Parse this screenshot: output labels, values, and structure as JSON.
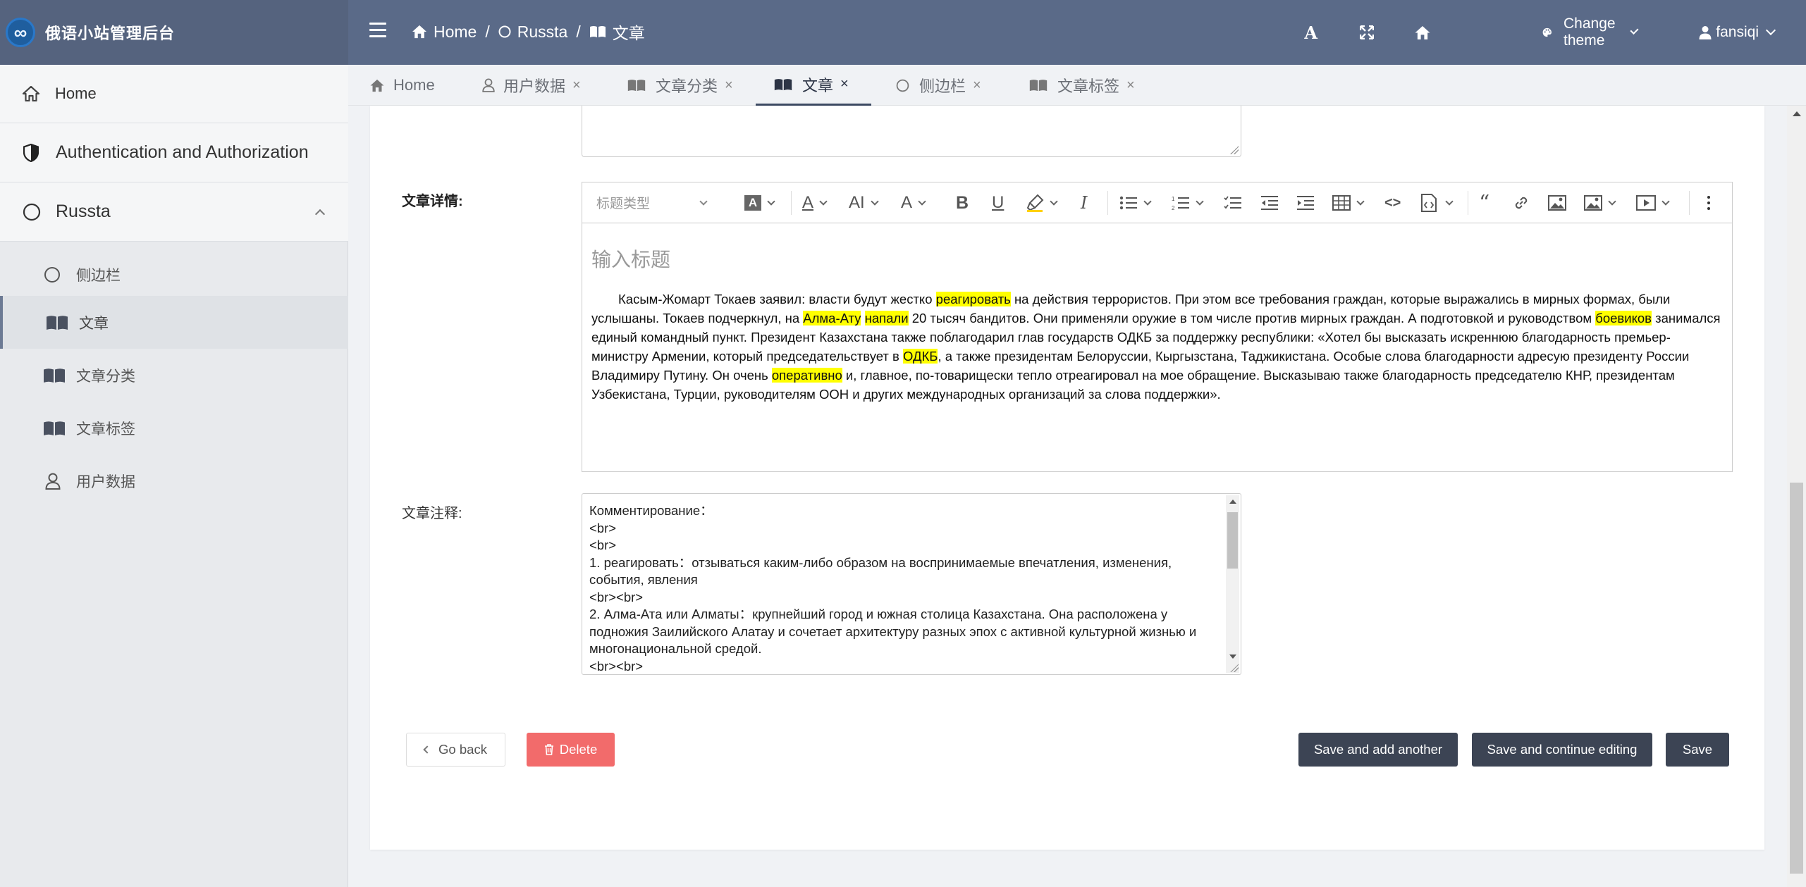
{
  "app": {
    "title": "俄语小站管理后台",
    "logo_glyph": "∞"
  },
  "breadcrumb": [
    {
      "label": "Home",
      "icon": "home-icon"
    },
    {
      "label": "Russta",
      "icon": "circle-icon"
    },
    {
      "label": "文章",
      "icon": "book-icon"
    }
  ],
  "breadcrumb_sep": "/",
  "header_right": {
    "font_icon": "A",
    "theme_label": "Change theme",
    "user_label": "fansiqi"
  },
  "sidebar": {
    "home": "Home",
    "auth": "Authentication and Authorization",
    "russta": "Russta",
    "items": [
      {
        "label": "侧边栏",
        "icon": "circle-icon"
      },
      {
        "label": "文章",
        "icon": "book-icon"
      },
      {
        "label": "文章分类",
        "icon": "book-icon"
      },
      {
        "label": "文章标签",
        "icon": "book-icon"
      },
      {
        "label": "用户数据",
        "icon": "user-icon"
      }
    ]
  },
  "tabs": [
    {
      "label": "Home",
      "icon": "home-icon",
      "closable": false
    },
    {
      "label": "用户数据",
      "icon": "user-icon",
      "closable": true
    },
    {
      "label": "文章分类",
      "icon": "book-icon",
      "closable": true
    },
    {
      "label": "文章",
      "icon": "book-icon",
      "closable": true,
      "active": true
    },
    {
      "label": "侧边栏",
      "icon": "circle-icon",
      "closable": true
    },
    {
      "label": "文章标签",
      "icon": "book-icon",
      "closable": true
    }
  ],
  "close_glyph": "×",
  "form": {
    "detail_label": "文章详情:",
    "notes_label": "文章注释:",
    "editor": {
      "heading_select": "标题类型",
      "title_placeholder": "输入标题",
      "body": [
        {
          "t": "Касым-Жомарт Токаев заявил: власти будут жестко "
        },
        {
          "t": "реагировать",
          "hl": true
        },
        {
          "t": " на действия террористов. При этом все требования граждан, которые выражались в мирных формах, были услышаны. Токаев подчеркнул, на "
        },
        {
          "t": "Алма-Ату",
          "hl": true
        },
        {
          "t": " "
        },
        {
          "t": "напали",
          "hl": true
        },
        {
          "t": " 20 тысяч бандитов. Они применяли оружие в том числе против мирных граждан. А подготовкой и руководством "
        },
        {
          "t": "боевиков",
          "hl": true
        },
        {
          "t": " занимался единый командный пункт. Президент Казахстана также поблагодарил глав государств ОДКБ за поддержку республики: «Хотел бы высказать искреннюю благодарность премьер-министру Армении, который председательствует в "
        },
        {
          "t": "ОДКБ",
          "hl": true
        },
        {
          "t": ", а также президентам Белоруссии, Кыргызстана, Таджикистана. Особые слова благодарности адресую президенту России Владимиру Путину. Он очень "
        },
        {
          "t": "оперативно",
          "hl": true
        },
        {
          "t": " и, главное, по-товарищески тепло отреагировал на мое обращение. Высказываю также благодарность председателю КНР, президентам Узбекистана, Турции, руководителям ООН и других международных организаций за слова поддержки»."
        }
      ]
    },
    "notes_text": "Комментирование：\n<br>\n<br>\n1. реагировать：отзываться каким-либо образом на воспринимаемые впечатления, изменения, события, явления\n<br><br>\n2. Алма-Ата или Алматы：крупнейший город и южная столица Казахстана. Она расположена у подножия Заилийского Алатау и сочетает архитектуру разных эпох с активной культурной жизнью и многонациональной средой.\n<br><br>"
  },
  "buttons": {
    "back": "Go back",
    "delete": "Delete",
    "save_add": "Save and add another",
    "save_continue": "Save and continue editing",
    "save": "Save"
  },
  "colors": {
    "header": "#5a6a88",
    "delete": "#f26b6b",
    "primary_dark": "#3c4454",
    "highlight": "#ffff00"
  }
}
